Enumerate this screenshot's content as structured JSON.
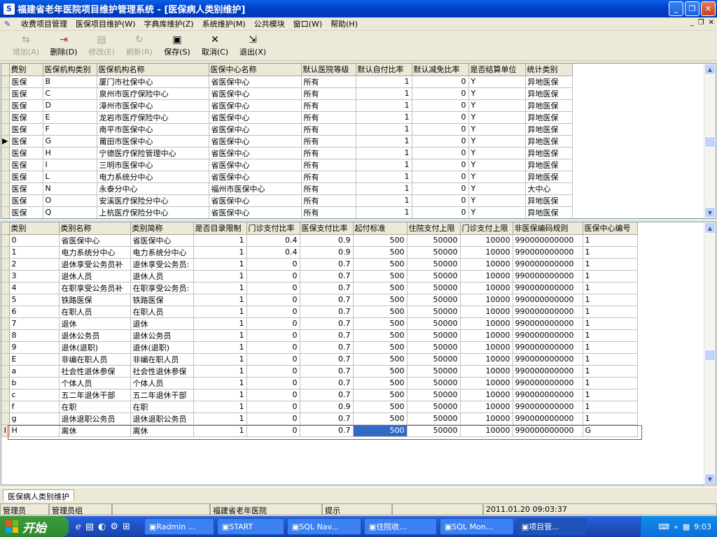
{
  "window": {
    "title": "福建省老年医院项目维护管理系统 - [医保病人类别维护]"
  },
  "menu": {
    "items": [
      "收费项目管理",
      "医保项目维护(W)",
      "字典库维护(Z)",
      "系统维护(M)",
      "公共模块",
      "窗口(W)",
      "帮助(H)"
    ]
  },
  "toolbar": {
    "buttons": [
      {
        "label": "增加(A)",
        "icon": "plus-icon",
        "enabled": false
      },
      {
        "label": "删除(D)",
        "icon": "delete-icon",
        "enabled": true
      },
      {
        "label": "修改(E)",
        "icon": "edit-icon",
        "enabled": false
      },
      {
        "label": "刷新(R)",
        "icon": "refresh-icon",
        "enabled": false
      },
      {
        "label": "保存(S)",
        "icon": "save-icon",
        "enabled": true
      },
      {
        "label": "取消(C)",
        "icon": "cancel-icon",
        "enabled": true
      },
      {
        "label": "退出(X)",
        "icon": "exit-icon",
        "enabled": true
      }
    ]
  },
  "grid1": {
    "columns": [
      "费别",
      "医保机构类别",
      "医保机构名称",
      "医保中心名称",
      "默认医院等级",
      "默认自付比率",
      "默认减免比率",
      "是否结算单位",
      "统计类别"
    ],
    "current_row": 5,
    "rows": [
      [
        "医保",
        "B",
        "厦门市社保中心",
        "省医保中心",
        "所有",
        "1",
        "0",
        "Y",
        "异地医保"
      ],
      [
        "医保",
        "C",
        "泉州市医疗保险中心",
        "省医保中心",
        "所有",
        "1",
        "0",
        "Y",
        "异地医保"
      ],
      [
        "医保",
        "D",
        "漳州市医保中心",
        "省医保中心",
        "所有",
        "1",
        "0",
        "Y",
        "异地医保"
      ],
      [
        "医保",
        "E",
        "龙岩市医疗保险中心",
        "省医保中心",
        "所有",
        "1",
        "0",
        "Y",
        "异地医保"
      ],
      [
        "医保",
        "F",
        "南平市医保中心",
        "省医保中心",
        "所有",
        "1",
        "0",
        "Y",
        "异地医保"
      ],
      [
        "医保",
        "G",
        "莆田市医保中心",
        "省医保中心",
        "所有",
        "1",
        "0",
        "Y",
        "异地医保"
      ],
      [
        "医保",
        "H",
        "宁德医疗保险管理中心",
        "省医保中心",
        "所有",
        "1",
        "0",
        "Y",
        "异地医保"
      ],
      [
        "医保",
        "I",
        "三明市医保中心",
        "省医保中心",
        "所有",
        "1",
        "0",
        "Y",
        "异地医保"
      ],
      [
        "医保",
        "L",
        "电力系统分中心",
        "省医保中心",
        "所有",
        "1",
        "0",
        "Y",
        "异地医保"
      ],
      [
        "医保",
        "N",
        "永泰分中心",
        "福州市医保中心",
        "所有",
        "1",
        "0",
        "Y",
        "大中心"
      ],
      [
        "医保",
        "O",
        "安溪医疗保险分中心",
        "省医保中心",
        "所有",
        "1",
        "0",
        "Y",
        "异地医保"
      ],
      [
        "医保",
        "Q",
        "上杭医疗保险分中心",
        "省医保中心",
        "所有",
        "1",
        "0",
        "Y",
        "异地医保"
      ]
    ]
  },
  "grid2": {
    "columns": [
      "类别",
      "类别名称",
      "类别简称",
      "是否目录限制",
      "门诊支付比率",
      "医保支付比率",
      "起付标准",
      "住院支付上限",
      "门诊支付上限",
      "非医保编码规则",
      "医保中心编号"
    ],
    "rows": [
      [
        "0",
        "省医保中心",
        "省医保中心",
        "1",
        "0.4",
        "0.9",
        "500",
        "50000",
        "10000",
        "990000000000",
        "1"
      ],
      [
        "1",
        "电力系统分中心",
        "电力系统分中心",
        "1",
        "0.4",
        "0.9",
        "500",
        "50000",
        "10000",
        "990000000000",
        "1"
      ],
      [
        "2",
        "退休享受公务员补",
        "退休享受公务员:",
        "1",
        "0",
        "0.7",
        "500",
        "50000",
        "10000",
        "990000000000",
        "1"
      ],
      [
        "3",
        "退休人员",
        "退休人员",
        "1",
        "0",
        "0.7",
        "500",
        "50000",
        "10000",
        "990000000000",
        "1"
      ],
      [
        "4",
        "在职享受公务员补",
        "在职享受公务员:",
        "1",
        "0",
        "0.7",
        "500",
        "50000",
        "10000",
        "990000000000",
        "1"
      ],
      [
        "5",
        "铁路医保",
        "铁路医保",
        "1",
        "0",
        "0.7",
        "500",
        "50000",
        "10000",
        "990000000000",
        "1"
      ],
      [
        "6",
        "在职人员",
        "在职人员",
        "1",
        "0",
        "0.7",
        "500",
        "50000",
        "10000",
        "990000000000",
        "1"
      ],
      [
        "7",
        "退休",
        "退休",
        "1",
        "0",
        "0.7",
        "500",
        "50000",
        "10000",
        "990000000000",
        "1"
      ],
      [
        "8",
        "退休公务员",
        "退休公务员",
        "1",
        "0",
        "0.7",
        "500",
        "50000",
        "10000",
        "990000000000",
        "1"
      ],
      [
        "9",
        "退休(退职)",
        "退休(退职)",
        "1",
        "0",
        "0.7",
        "500",
        "50000",
        "10000",
        "990000000000",
        "1"
      ],
      [
        "E",
        "非编在职人员",
        "非编在职人员",
        "1",
        "0",
        "0.7",
        "500",
        "50000",
        "10000",
        "990000000000",
        "1"
      ],
      [
        "a",
        "社会性退休参保",
        "社会性退休参保",
        "1",
        "0",
        "0.7",
        "500",
        "50000",
        "10000",
        "990000000000",
        "1"
      ],
      [
        "b",
        "个体人员",
        "个体人员",
        "1",
        "0",
        "0.7",
        "500",
        "50000",
        "10000",
        "990000000000",
        "1"
      ],
      [
        "c",
        "五二年退休干部",
        "五二年退休干部",
        "1",
        "0",
        "0.7",
        "500",
        "50000",
        "10000",
        "990000000000",
        "1"
      ],
      [
        "f",
        "在职",
        "在职",
        "1",
        "0",
        "0.9",
        "500",
        "50000",
        "10000",
        "990000000000",
        "1"
      ],
      [
        "g",
        "退休退职公务员",
        "退休退职公务员",
        "1",
        "0",
        "0.7",
        "500",
        "50000",
        "10000",
        "990000000000",
        "1"
      ],
      [
        "H",
        "离休",
        "离休",
        "1",
        "0",
        "0.7",
        "500",
        "50000",
        "10000",
        "990000000000",
        "G"
      ]
    ],
    "edit_row": 16,
    "edit_col": 6
  },
  "mdi_tab": "医保病人类别维护",
  "statusbar": [
    "管理员",
    "管理员组",
    "",
    "福建省老年医院",
    "提示",
    "",
    "2011.01.20  09:03:37"
  ],
  "taskbar": {
    "start": "开始",
    "tasks": [
      "Radmin ...",
      "START",
      "SQL Nav...",
      "住院收...",
      "SQL Mon...",
      "项目管..."
    ],
    "active_task": 5,
    "clock": "9:03"
  },
  "colors": {
    "titlebar": "#0042c8",
    "selection": "#316ac5",
    "edit_border": "#ff5050"
  }
}
